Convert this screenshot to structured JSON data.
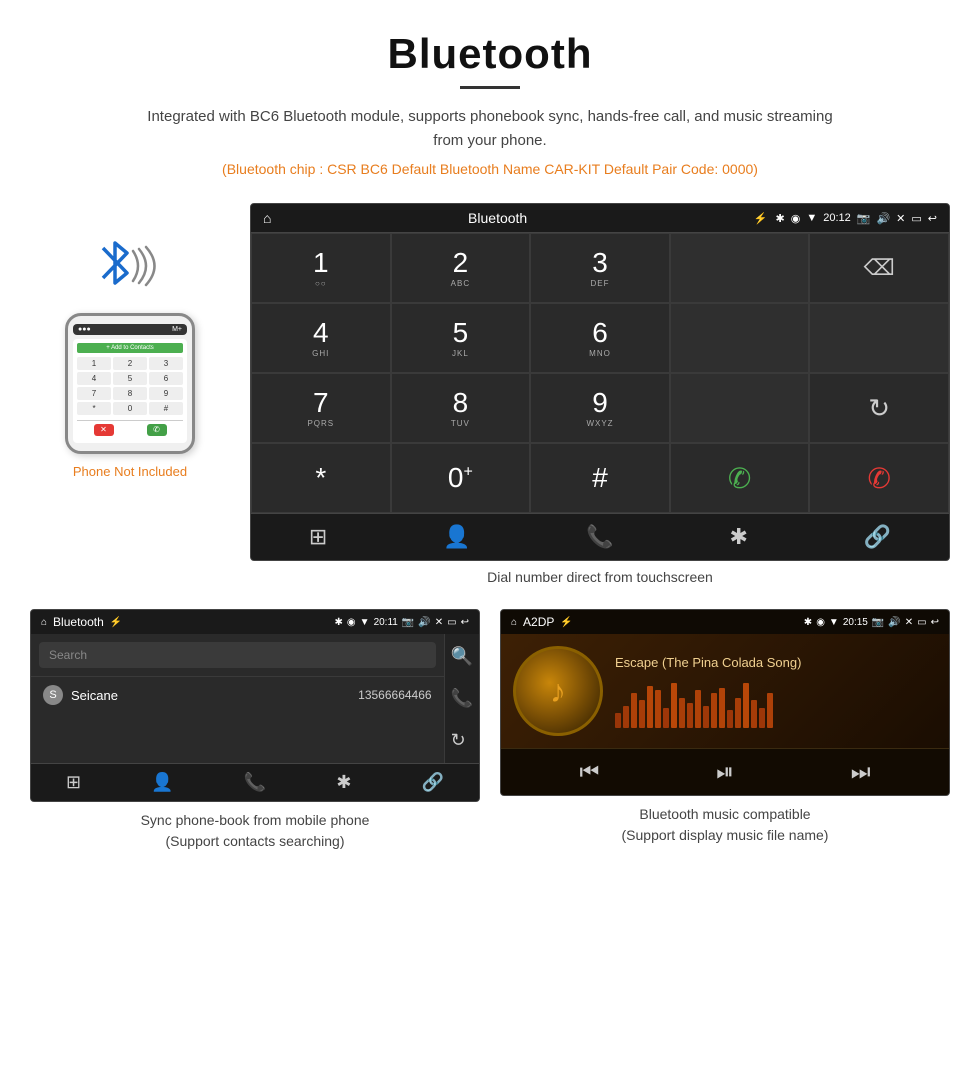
{
  "page": {
    "title": "Bluetooth",
    "description": "Integrated with BC6 Bluetooth module, supports phonebook sync, hands-free call, and music streaming from your phone.",
    "bt_info": "(Bluetooth chip : CSR BC6    Default Bluetooth Name CAR-KIT    Default Pair Code: 0000)",
    "dial_caption": "Dial number direct from touchscreen",
    "phone_not_included": "Phone Not Included"
  },
  "dialer": {
    "title": "Bluetooth",
    "status_time": "20:12",
    "keys": [
      {
        "num": "1",
        "sub": ""
      },
      {
        "num": "2",
        "sub": "ABC"
      },
      {
        "num": "3",
        "sub": "DEF"
      },
      {
        "num": "",
        "sub": ""
      },
      {
        "num": "⌫",
        "sub": ""
      },
      {
        "num": "4",
        "sub": "GHI"
      },
      {
        "num": "5",
        "sub": "JKL"
      },
      {
        "num": "6",
        "sub": "MNO"
      },
      {
        "num": "",
        "sub": ""
      },
      {
        "num": "",
        "sub": ""
      },
      {
        "num": "7",
        "sub": "PQRS"
      },
      {
        "num": "8",
        "sub": "TUV"
      },
      {
        "num": "9",
        "sub": "WXYZ"
      },
      {
        "num": "",
        "sub": ""
      },
      {
        "num": "↺",
        "sub": ""
      },
      {
        "num": "*",
        "sub": ""
      },
      {
        "num": "0",
        "sub": "+"
      },
      {
        "num": "#",
        "sub": ""
      },
      {
        "num": "📞green",
        "sub": ""
      },
      {
        "num": "📞red",
        "sub": ""
      }
    ]
  },
  "phonebook": {
    "title": "Bluetooth",
    "status_time": "20:11",
    "search_placeholder": "Search",
    "contact": {
      "letter": "S",
      "name": "Seicane",
      "number": "13566664466"
    },
    "caption_line1": "Sync phone-book from mobile phone",
    "caption_line2": "(Support contacts searching)"
  },
  "music": {
    "title": "A2DP",
    "status_time": "20:15",
    "song_title": "Escape (The Pina Colada Song)",
    "caption_line1": "Bluetooth music compatible",
    "caption_line2": "(Support display music file name)"
  },
  "toolbar_icons": {
    "grid": "⊞",
    "person": "👤",
    "phone": "📞",
    "bluetooth": "✱",
    "link": "🔗"
  },
  "eq_heights": [
    15,
    22,
    35,
    28,
    42,
    38,
    20,
    45,
    30,
    25,
    38,
    22,
    35,
    40,
    18,
    30,
    45,
    28,
    20,
    35
  ]
}
